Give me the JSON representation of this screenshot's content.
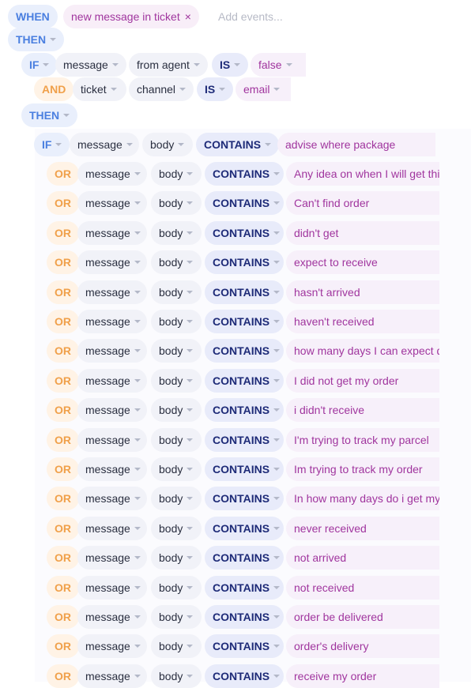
{
  "when": {
    "label": "WHEN",
    "event": "new message in ticket",
    "remove_symbol": "×",
    "add_placeholder": "Add events..."
  },
  "then_label": "THEN",
  "if_label": "IF",
  "and_label": "AND",
  "or_label": "OR",
  "outer_conditions": [
    {
      "field1": "message",
      "field2": "from agent",
      "op": "IS",
      "value": "false"
    },
    {
      "field1": "ticket",
      "field2": "channel",
      "op": "IS",
      "value": "email"
    }
  ],
  "inner_conditions": [
    {
      "field1": "message",
      "field2": "body",
      "op": "CONTAINS",
      "value": "advise where package"
    },
    {
      "field1": "message",
      "field2": "body",
      "op": "CONTAINS",
      "value": "Any idea on when I will get thi"
    },
    {
      "field1": "message",
      "field2": "body",
      "op": "CONTAINS",
      "value": "Can't find order"
    },
    {
      "field1": "message",
      "field2": "body",
      "op": "CONTAINS",
      "value": "didn't get"
    },
    {
      "field1": "message",
      "field2": "body",
      "op": "CONTAINS",
      "value": "expect to receive"
    },
    {
      "field1": "message",
      "field2": "body",
      "op": "CONTAINS",
      "value": "hasn't arrived"
    },
    {
      "field1": "message",
      "field2": "body",
      "op": "CONTAINS",
      "value": "haven't received"
    },
    {
      "field1": "message",
      "field2": "body",
      "op": "CONTAINS",
      "value": "how many days I can expect d"
    },
    {
      "field1": "message",
      "field2": "body",
      "op": "CONTAINS",
      "value": "I did not get my order"
    },
    {
      "field1": "message",
      "field2": "body",
      "op": "CONTAINS",
      "value": "i didn't receive"
    },
    {
      "field1": "message",
      "field2": "body",
      "op": "CONTAINS",
      "value": "I'm trying to track my parcel"
    },
    {
      "field1": "message",
      "field2": "body",
      "op": "CONTAINS",
      "value": "Im trying to track my order"
    },
    {
      "field1": "message",
      "field2": "body",
      "op": "CONTAINS",
      "value": "In how many days do i get my"
    },
    {
      "field1": "message",
      "field2": "body",
      "op": "CONTAINS",
      "value": "never received"
    },
    {
      "field1": "message",
      "field2": "body",
      "op": "CONTAINS",
      "value": "not arrived"
    },
    {
      "field1": "message",
      "field2": "body",
      "op": "CONTAINS",
      "value": "not received"
    },
    {
      "field1": "message",
      "field2": "body",
      "op": "CONTAINS",
      "value": "order be delivered"
    },
    {
      "field1": "message",
      "field2": "body",
      "op": "CONTAINS",
      "value": "order's delivery"
    },
    {
      "field1": "message",
      "field2": "body",
      "op": "CONTAINS",
      "value": "receive my order"
    }
  ],
  "colors": {
    "keyword_blue": "#4a7fe0",
    "keyword_orange": "#f0a04a",
    "operator": "#1e2b78",
    "value_text": "#a0359e"
  }
}
